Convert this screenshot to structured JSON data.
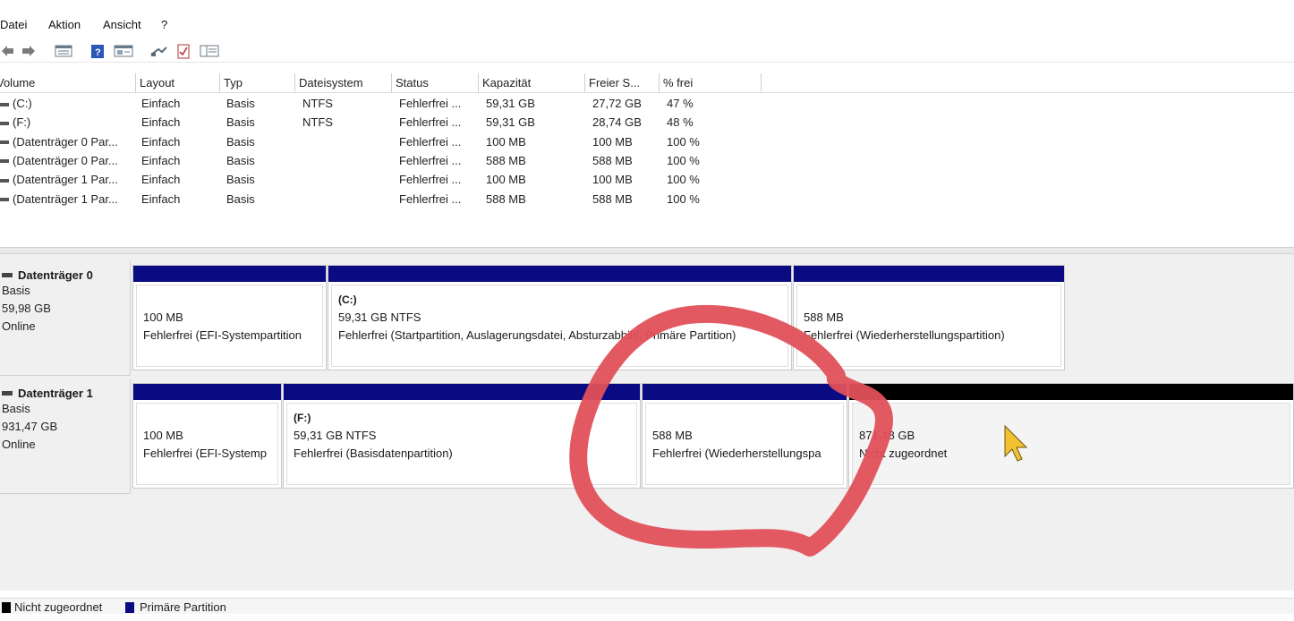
{
  "menu": [
    "Datei",
    "Aktion",
    "Ansicht",
    "?"
  ],
  "table": {
    "columns": [
      "Volume",
      "Layout",
      "Typ",
      "Dateisystem",
      "Status",
      "Kapazität",
      "Freier S...",
      "% frei"
    ],
    "rows": [
      [
        "(C:)",
        "Einfach",
        "Basis",
        "NTFS",
        "Fehlerfrei ...",
        "59,31 GB",
        "27,72 GB",
        "47 %"
      ],
      [
        "(F:)",
        "Einfach",
        "Basis",
        "NTFS",
        "Fehlerfrei ...",
        "59,31 GB",
        "28,74 GB",
        "48 %"
      ],
      [
        "(Datenträger 0 Par...",
        "Einfach",
        "Basis",
        "",
        "Fehlerfrei ...",
        "100 MB",
        "100 MB",
        "100 %"
      ],
      [
        "(Datenträger 0 Par...",
        "Einfach",
        "Basis",
        "",
        "Fehlerfrei ...",
        "588 MB",
        "588 MB",
        "100 %"
      ],
      [
        "(Datenträger 1 Par...",
        "Einfach",
        "Basis",
        "",
        "Fehlerfrei ...",
        "100 MB",
        "100 MB",
        "100 %"
      ],
      [
        "(Datenträger 1 Par...",
        "Einfach",
        "Basis",
        "",
        "Fehlerfrei ...",
        "588 MB",
        "588 MB",
        "100 %"
      ]
    ]
  },
  "disks": [
    {
      "name": "Datenträger 0",
      "type": "Basis",
      "size": "59,98 GB",
      "state": "Online",
      "partitions": [
        {
          "label": "",
          "size": "100 MB",
          "status": "Fehlerfrei (EFI-Systempartition"
        },
        {
          "label": "(C:)",
          "size": "59,31 GB NTFS",
          "status": "Fehlerfrei (Startpartition, Auslagerungsdatei, Absturzabbild, Primäre Partition)"
        },
        {
          "label": "",
          "size": "588 MB",
          "status": "Fehlerfrei (Wiederherstellungspartition)"
        }
      ]
    },
    {
      "name": "Datenträger 1",
      "type": "Basis",
      "size": "931,47 GB",
      "state": "Online",
      "partitions": [
        {
          "label": "",
          "size": "100 MB",
          "status": "Fehlerfrei (EFI-Systemp"
        },
        {
          "label": "(F:)",
          "size": "59,31 GB NTFS",
          "status": "Fehlerfrei (Basisdatenpartition)"
        },
        {
          "label": "",
          "size": "588 MB",
          "status": "Fehlerfrei (Wiederherstellungspa"
        },
        {
          "label": "",
          "size": "871,48 GB",
          "status": "Nicht zugeordnet"
        }
      ]
    }
  ],
  "legend": [
    {
      "label": "Nicht zugeordnet",
      "color": "#000000"
    },
    {
      "label": "Primäre Partition",
      "color": "#0a0a82"
    }
  ],
  "colors": {
    "primary_partition": "#0a0a82",
    "unallocated": "#000000",
    "annotation": "#e0505a",
    "cursor": "#f2c230"
  }
}
